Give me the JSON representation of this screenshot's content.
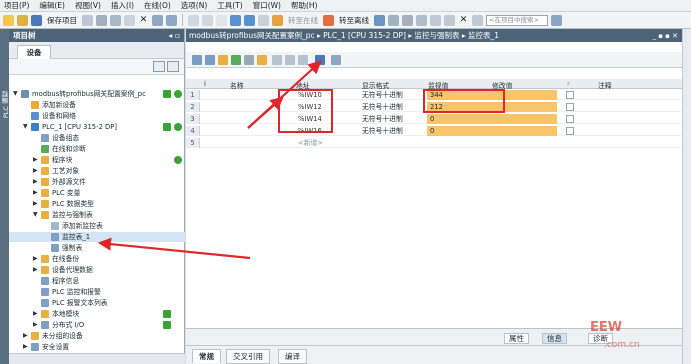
{
  "menu": [
    "项目(P)",
    "编辑(E)",
    "视图(V)",
    "插入(I)",
    "在线(O)",
    "选项(N)",
    "工具(T)",
    "窗口(W)",
    "帮助(H)"
  ],
  "toolbar": {
    "save_label": "保存项目",
    "go_online": "转至在线",
    "go_offline": "转至离线",
    "search_placeholder": "<在项目中搜索>"
  },
  "left_strip_label": "PLC 编程",
  "tree": {
    "title": "项目树",
    "tab_label": "设备",
    "items": [
      {
        "label": "modbus转profibus网关配置案例_pc",
        "indent": 0,
        "expand": "▼",
        "color": "#6d8fb0",
        "check": true,
        "dot": true
      },
      {
        "label": "添加新设备",
        "indent": 1,
        "expand": "",
        "color": "#f0a830",
        "check": false,
        "dot": false
      },
      {
        "label": "设备和网络",
        "indent": 1,
        "expand": "",
        "color": "#5c8fd0",
        "check": false,
        "dot": false
      },
      {
        "label": "PLC_1 [CPU 315-2 DP]",
        "indent": 1,
        "expand": "▼",
        "color": "#3d7fc8",
        "check": true,
        "dot": true
      },
      {
        "label": "设备组态",
        "indent": 2,
        "expand": "",
        "color": "#7fa0c2",
        "check": false,
        "dot": false
      },
      {
        "label": "在线和诊断",
        "indent": 2,
        "expand": "",
        "color": "#5aa95c",
        "check": false,
        "dot": false
      },
      {
        "label": "程序块",
        "indent": 2,
        "expand": "▶",
        "color": "#e8b040",
        "check": false,
        "dot": true
      },
      {
        "label": "工艺对象",
        "indent": 2,
        "expand": "▶",
        "color": "#e8b040",
        "check": false,
        "dot": false
      },
      {
        "label": "外部源文件",
        "indent": 2,
        "expand": "▶",
        "color": "#e8b040",
        "check": false,
        "dot": false
      },
      {
        "label": "PLC 变量",
        "indent": 2,
        "expand": "▶",
        "color": "#e8b040",
        "check": false,
        "dot": false
      },
      {
        "label": "PLC 数据类型",
        "indent": 2,
        "expand": "▶",
        "color": "#e8b040",
        "check": false,
        "dot": false
      },
      {
        "label": "监控与强制表",
        "indent": 2,
        "expand": "▼",
        "color": "#e8b040",
        "check": false,
        "dot": false
      },
      {
        "label": "添加新监控表",
        "indent": 3,
        "expand": "",
        "color": "#9fb7cf",
        "check": false,
        "dot": false
      },
      {
        "label": "监控表_1",
        "indent": 3,
        "expand": "",
        "color": "#7fa0c2",
        "check": false,
        "dot": false,
        "selected": true
      },
      {
        "label": "强制表",
        "indent": 3,
        "expand": "",
        "color": "#7fa0c2",
        "check": false,
        "dot": false
      },
      {
        "label": "在线备份",
        "indent": 2,
        "expand": "▶",
        "color": "#e8b040",
        "check": false,
        "dot": false
      },
      {
        "label": "设备代理数据",
        "indent": 2,
        "expand": "▶",
        "color": "#e8b040",
        "check": false,
        "dot": false
      },
      {
        "label": "程序信息",
        "indent": 2,
        "expand": "",
        "color": "#7fa0c2",
        "check": false,
        "dot": false
      },
      {
        "label": "PLC 监控和报警",
        "indent": 2,
        "expand": "",
        "color": "#7fa0c2",
        "check": false,
        "dot": false
      },
      {
        "label": "PLC 报警文本列表",
        "indent": 2,
        "expand": "",
        "color": "#7fa0c2",
        "check": false,
        "dot": false
      },
      {
        "label": "本地模块",
        "indent": 2,
        "expand": "▶",
        "color": "#e8b040",
        "check": true,
        "dot": false
      },
      {
        "label": "分布式 I/O",
        "indent": 2,
        "expand": "▶",
        "color": "#7fa0c2",
        "check": true,
        "dot": false
      },
      {
        "label": "未分组的设备",
        "indent": 1,
        "expand": "▶",
        "color": "#e8b040",
        "check": false,
        "dot": false
      },
      {
        "label": "安全设置",
        "indent": 1,
        "expand": "▶",
        "color": "#7fa0c2",
        "check": false,
        "dot": false
      }
    ]
  },
  "editor": {
    "breadcrumb": "modbus转profibus网关配置案例_pc ▸ PLC_1 [CPU 315-2 DP] ▸ 监控与强制表 ▸ 监控表_1",
    "window_controls": "_ ▪ ▪ ✕",
    "columns": {
      "index": "i",
      "name": "名称",
      "address": "地址",
      "format": "显示格式",
      "monitor": "监视值",
      "modify": "修改值",
      "flag": "⚡",
      "comment": "注释"
    },
    "rows": [
      {
        "num": "1",
        "address": "%IW10",
        "format": "无符号十进制",
        "value": "344"
      },
      {
        "num": "2",
        "address": "%IW12",
        "format": "无符号十进制",
        "value": "212"
      },
      {
        "num": "3",
        "address": "%IW14",
        "format": "无符号十进制",
        "value": "0"
      },
      {
        "num": "4",
        "address": "%IW16",
        "format": "无符号十进制",
        "value": "0"
      },
      {
        "num": "5",
        "address": "<新增>",
        "format": "",
        "value": ""
      }
    ]
  },
  "inspector": {
    "properties": "属性",
    "info": "信息",
    "diagnostics": "诊断",
    "tabs": [
      "常规",
      "交叉引用",
      "编译"
    ]
  },
  "watermark": "EEW",
  "watermark_sub": ".com.cn",
  "colors": {
    "header": "#4d6478",
    "value_fill": "#f7c46a",
    "annotation": "#e0262b",
    "ok": "#3aa335"
  }
}
